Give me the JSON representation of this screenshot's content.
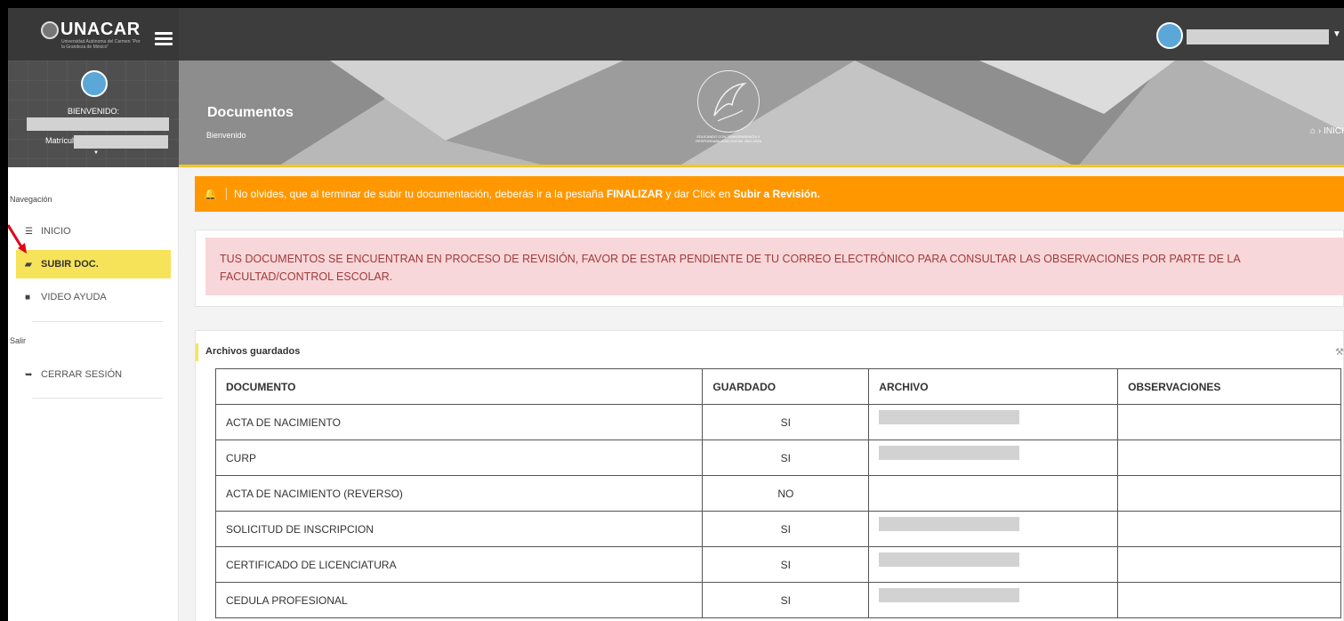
{
  "brand": {
    "name": "UNACAR",
    "subtitle": "Universidad Autónoma del Carmen \"Por la Grandeza de México\""
  },
  "profile": {
    "welcome_label": "BIENVENIDO:",
    "matricula_label": "Matrícula:"
  },
  "sidebar": {
    "nav_heading": "Navegación",
    "items": [
      {
        "label": "INICIO",
        "icon": "list-icon"
      },
      {
        "label": "SUBIR DOC.",
        "icon": "folder-open-icon",
        "active": true
      },
      {
        "label": "VIDEO AYUDA",
        "icon": "video-camera-icon"
      }
    ],
    "exit_heading": "Salir",
    "logout": {
      "label": "CERRAR SESIÓN",
      "icon": "sign-out-icon"
    }
  },
  "banner": {
    "title": "Documentos",
    "subtitle": "Bienvenido",
    "breadcrumb": "INICIO",
    "motto": "EDUCANDO CON TRANSPARENCIA Y RESPONSABILIDAD SOCIAL 2022-2026"
  },
  "alert": {
    "text_1": "No olvides, que al terminar de subir tu documentación, deberás ir a la pestaña ",
    "bold_1": "FINALIZAR",
    "text_2": " y dar Click en ",
    "bold_2": "Subir a Revisión."
  },
  "notice": "TUS DOCUMENTOS SE ENCUENTRAN EN PROCESO DE REVISIÓN, FAVOR DE ESTAR PENDIENTE DE TU CORREO ELECTRÓNICO PARA CONSULTAR LAS OBSERVACIONES POR PARTE DE LA FACULTAD/CONTROL ESCOLAR.",
  "files": {
    "title": "Archivos guardados",
    "columns": [
      "DOCUMENTO",
      "GUARDADO",
      "ARCHIVO",
      "OBSERVACIONES"
    ],
    "rows": [
      {
        "documento": "ACTA DE NACIMIENTO",
        "guardado": "SI",
        "has_file": true
      },
      {
        "documento": "CURP",
        "guardado": "SI",
        "has_file": true
      },
      {
        "documento": "ACTA DE NACIMIENTO (REVERSO)",
        "guardado": "NO",
        "has_file": false
      },
      {
        "documento": "SOLICITUD DE INSCRIPCION",
        "guardado": "SI",
        "has_file": true
      },
      {
        "documento": "CERTIFICADO DE LICENCIATURA",
        "guardado": "SI",
        "has_file": true
      },
      {
        "documento": "CEDULA PROFESIONAL",
        "guardado": "SI",
        "has_file": true
      }
    ]
  },
  "colors": {
    "alert": "#ff9800",
    "active_nav": "#f7e359",
    "notice_bg": "#f8d7da",
    "notice_text": "#a13a3a",
    "topbar": "#3d3d3d"
  }
}
